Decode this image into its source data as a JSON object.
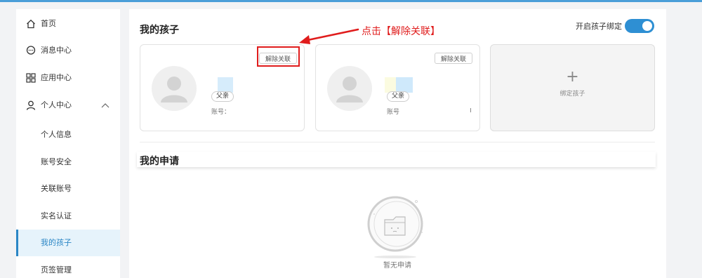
{
  "sidebar": {
    "items": [
      {
        "label": "首页",
        "icon": "home-icon"
      },
      {
        "label": "消息中心",
        "icon": "message-icon"
      },
      {
        "label": "应用中心",
        "icon": "apps-grid-icon"
      },
      {
        "label": "个人中心",
        "icon": "user-icon",
        "expanded": true
      }
    ],
    "sub_items": [
      {
        "label": "个人信息"
      },
      {
        "label": "账号安全"
      },
      {
        "label": "关联账号"
      },
      {
        "label": "实名认证"
      },
      {
        "label": "我的孩子",
        "active": true
      },
      {
        "label": "页签管理"
      }
    ]
  },
  "main": {
    "children_title": "我的孩子",
    "toggle_label": "开启孩子绑定",
    "toggle_on": true,
    "cards": [
      {
        "unbind_label": "解除关联",
        "relation": "父亲",
        "account_label": "账号：",
        "account_colon": ""
      },
      {
        "unbind_label": "解除关联",
        "relation": "父亲",
        "account_label": "账号",
        "account_colon": ""
      }
    ],
    "add_card": {
      "plus": "+",
      "label": "绑定孩子"
    },
    "applications_title": "我的申请",
    "empty_text": "暂无申请"
  },
  "annotation": {
    "text": "点击【解除关联】",
    "color": "#e01c1c"
  },
  "colors": {
    "accent": "#2b86c5",
    "toggle": "#2e8fd3",
    "annotation": "#e01c1c"
  }
}
